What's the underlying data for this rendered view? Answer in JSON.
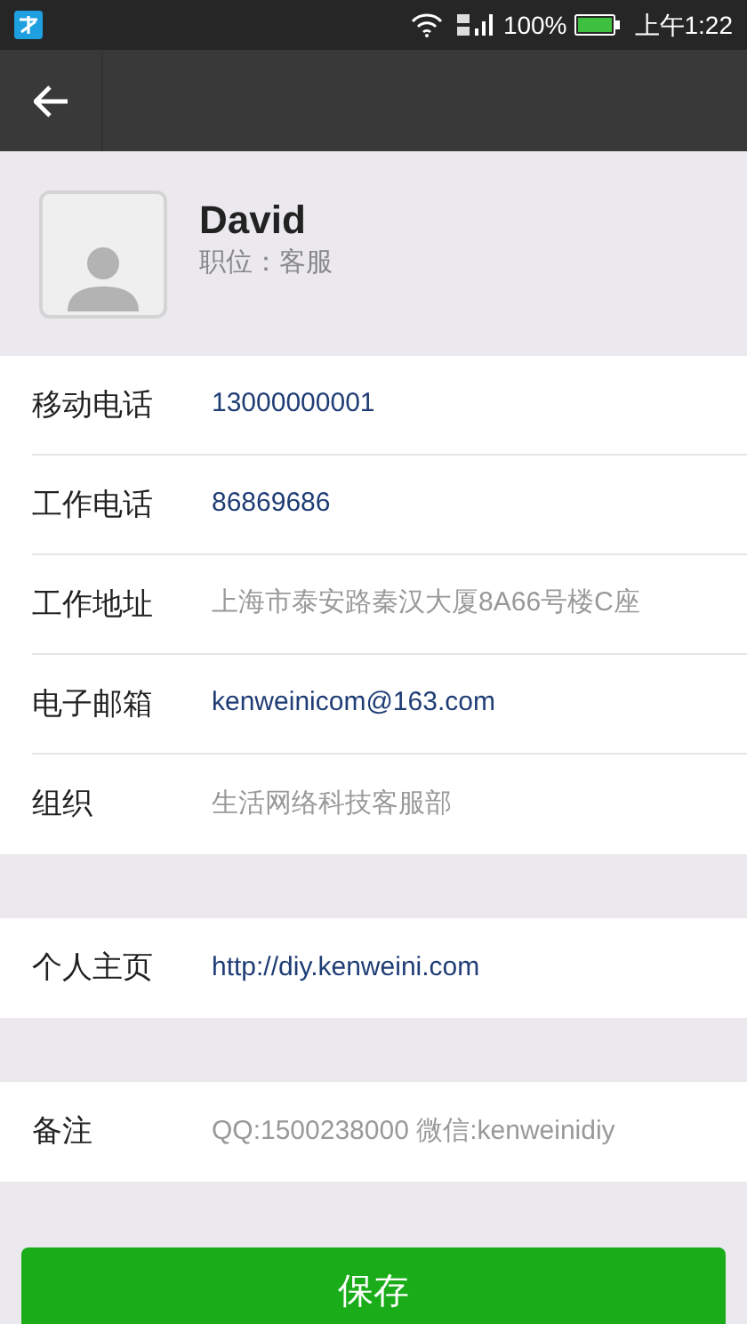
{
  "status_bar": {
    "battery": "100%",
    "time": "上午1:22"
  },
  "profile": {
    "name": "David",
    "position": "职位：客服"
  },
  "groups": [
    {
      "rows": [
        {
          "label": "移动电话",
          "value": "13000000001",
          "kind": "link"
        },
        {
          "label": "工作电话",
          "value": "86869686",
          "kind": "link"
        },
        {
          "label": "工作地址",
          "value": "上海市泰安路秦汉大厦8A66号楼C座",
          "kind": "text"
        },
        {
          "label": "电子邮箱",
          "value": "kenweinicom@163.com",
          "kind": "link"
        },
        {
          "label": "组织",
          "value": "生活网络科技客服部",
          "kind": "text"
        }
      ]
    },
    {
      "rows": [
        {
          "label": "个人主页",
          "value": "http://diy.kenweini.com",
          "kind": "link"
        }
      ]
    },
    {
      "rows": [
        {
          "label": "备注",
          "value": "QQ:1500238000 微信:kenweinidiy",
          "kind": "text"
        }
      ]
    }
  ],
  "save_button": "保存"
}
